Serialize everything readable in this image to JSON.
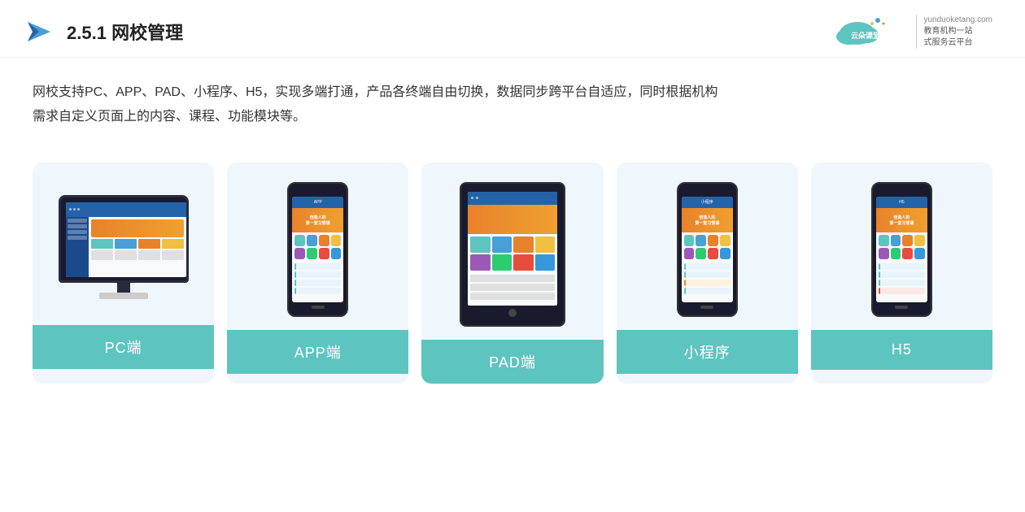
{
  "header": {
    "section_number": "2.5.1",
    "title": "网校管理",
    "logo_name": "云朵课堂",
    "logo_url": "yunduoketang.com",
    "logo_tagline_line1": "教育机构一站",
    "logo_tagline_line2": "式服务云平台"
  },
  "description": {
    "text_line1": "网校支持PC、APP、PAD、小程序、H5，实现多端打通，产品各终端自由切换，数据同步跨平台自适应，同时根据机构",
    "text_line2": "需求自定义页面上的内容、课程、功能模块等。"
  },
  "cards": [
    {
      "id": "pc",
      "label": "PC端",
      "device_type": "pc"
    },
    {
      "id": "app",
      "label": "APP端",
      "device_type": "phone"
    },
    {
      "id": "pad",
      "label": "PAD端",
      "device_type": "tablet"
    },
    {
      "id": "mini",
      "label": "小程序",
      "device_type": "phone2"
    },
    {
      "id": "h5",
      "label": "H5",
      "device_type": "phone3"
    }
  ],
  "colors": {
    "card_bg": "#e8f4fb",
    "card_label_bg": "#5ec4c0",
    "accent_orange": "#e8822a",
    "accent_blue": "#2563a8"
  }
}
